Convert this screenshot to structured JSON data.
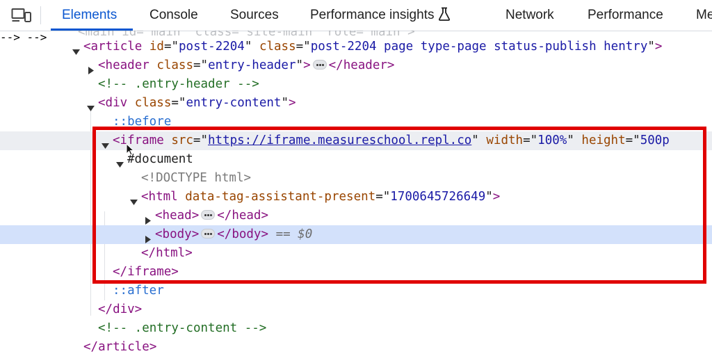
{
  "tabs": [
    {
      "id": "elements",
      "label": "Elements",
      "active": true
    },
    {
      "id": "console",
      "label": "Console"
    },
    {
      "id": "sources",
      "label": "Sources"
    },
    {
      "id": "performance-insights",
      "label": "Performance insights"
    },
    {
      "id": "network",
      "label": "Network"
    },
    {
      "id": "performance",
      "label": "Performance"
    },
    {
      "id": "more",
      "label": "Me"
    }
  ],
  "icons": {
    "device_toolbar": "device-toggle-icon",
    "insights_badge": "flask-icon",
    "expand": "triangle-down-icon",
    "collapse": "triangle-right-icon"
  },
  "colors": {
    "accent": "#0b57d0",
    "highlight_border": "#e00000",
    "selected_row": "#d3e1fb",
    "tag": "#881280",
    "attr_name": "#994500",
    "attr_value": "#1a1aa6",
    "comment": "#236e25"
  },
  "tree": {
    "cutoff": "<main id=\"main\" class=\"site-main\" role=\"main\">",
    "article_open": {
      "tag": "article",
      "attrs": [
        [
          "id",
          "post-2204"
        ],
        [
          "class",
          "post-2204 page type-page status-publish hentry"
        ]
      ]
    },
    "header_open": {
      "tag": "header",
      "attrs": [
        [
          "class",
          "entry-header"
        ]
      ],
      "close": "header"
    },
    "comment_header": "<!-- .entry-header -->",
    "div_open": {
      "tag": "div",
      "attrs": [
        [
          "class",
          "entry-content"
        ]
      ]
    },
    "before": "::before",
    "iframe_open": {
      "tag": "iframe",
      "src_name": "src",
      "src_value": "https://iframe.measureschool.repl.co",
      "width_name": "width",
      "width_value": "100%",
      "height_name": "height",
      "height_value": "500p"
    },
    "document": "#document",
    "doctype": "<!DOCTYPE html>",
    "html_open": {
      "tag": "html",
      "attr_name": "data-tag-assistant-present",
      "attr_value": "1700645726649"
    },
    "head": {
      "tag": "head",
      "close": "head"
    },
    "body": {
      "tag": "body",
      "close": "body",
      "marker": "== $0"
    },
    "html_close": "</html>",
    "iframe_close": "</iframe>",
    "after": "::after",
    "div_close": "</div>",
    "comment_content": "<!-- .entry-content -->",
    "article_close": "</article>"
  }
}
